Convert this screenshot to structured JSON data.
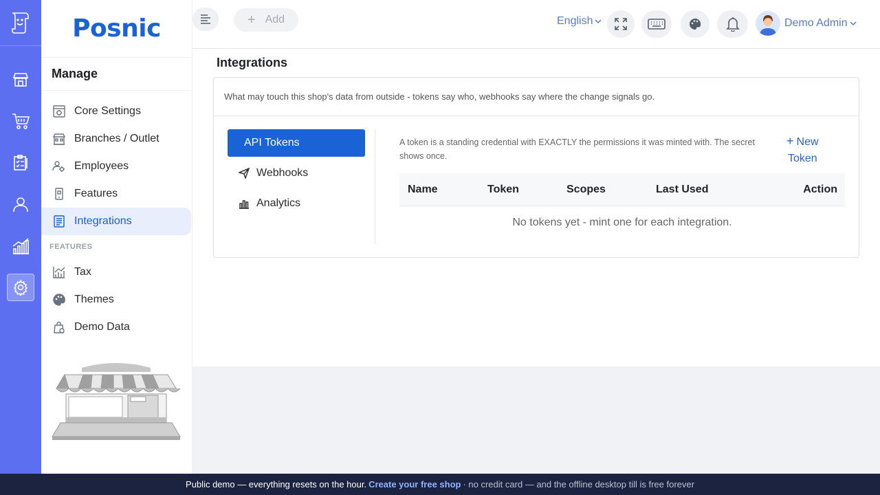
{
  "brand": {
    "name": "Posnic"
  },
  "rail": {
    "items": [
      "store-icon",
      "cart-icon",
      "clipboard-icon",
      "user-icon",
      "chart-icon",
      "settings-icon"
    ]
  },
  "sidebar": {
    "section_title": "Manage",
    "items": [
      {
        "label": "Core Settings",
        "icon": "settings-doc-icon"
      },
      {
        "label": "Branches / Outlet",
        "icon": "building-icon"
      },
      {
        "label": "Employees",
        "icon": "people-gear-icon"
      },
      {
        "label": "Features",
        "icon": "device-icon"
      },
      {
        "label": "Integrations",
        "icon": "list-doc-icon",
        "active": true
      }
    ],
    "features_heading": "FEATURES",
    "feature_items": [
      {
        "label": "Tax",
        "icon": "tax-chart-icon"
      },
      {
        "label": "Themes",
        "icon": "palette-icon"
      },
      {
        "label": "Demo Data",
        "icon": "bag-icon"
      }
    ]
  },
  "topbar": {
    "add_label": "Add",
    "language": "English",
    "user_name": "Demo Admin"
  },
  "page": {
    "title": "Integrations",
    "description": "What may touch this shop's data from outside - tokens say who, webhooks say where the change signals go."
  },
  "tabs": [
    {
      "label": "API Tokens",
      "active": true
    },
    {
      "label": "Webhooks"
    },
    {
      "label": "Analytics"
    }
  ],
  "tokens_panel": {
    "info": "A token is a standing credential with EXACTLY the permissions it was minted with. The secret shows once.",
    "new_token_line1": "New",
    "new_token_line2": "Token",
    "columns": [
      "Name",
      "Token",
      "Scopes",
      "Last Used",
      "Action"
    ],
    "empty_message": "No tokens yet - mint one for each integration."
  },
  "banner": {
    "prefix": "Public demo — everything resets on the hour.",
    "link": "Create your free shop",
    "suffix": "· no credit card — and the offline desktop till is free forever"
  },
  "colors": {
    "rail": "#5b6ff0",
    "brand": "#1a63d6",
    "active_bg": "#e8eefc",
    "banner_bg": "#1c2340"
  }
}
